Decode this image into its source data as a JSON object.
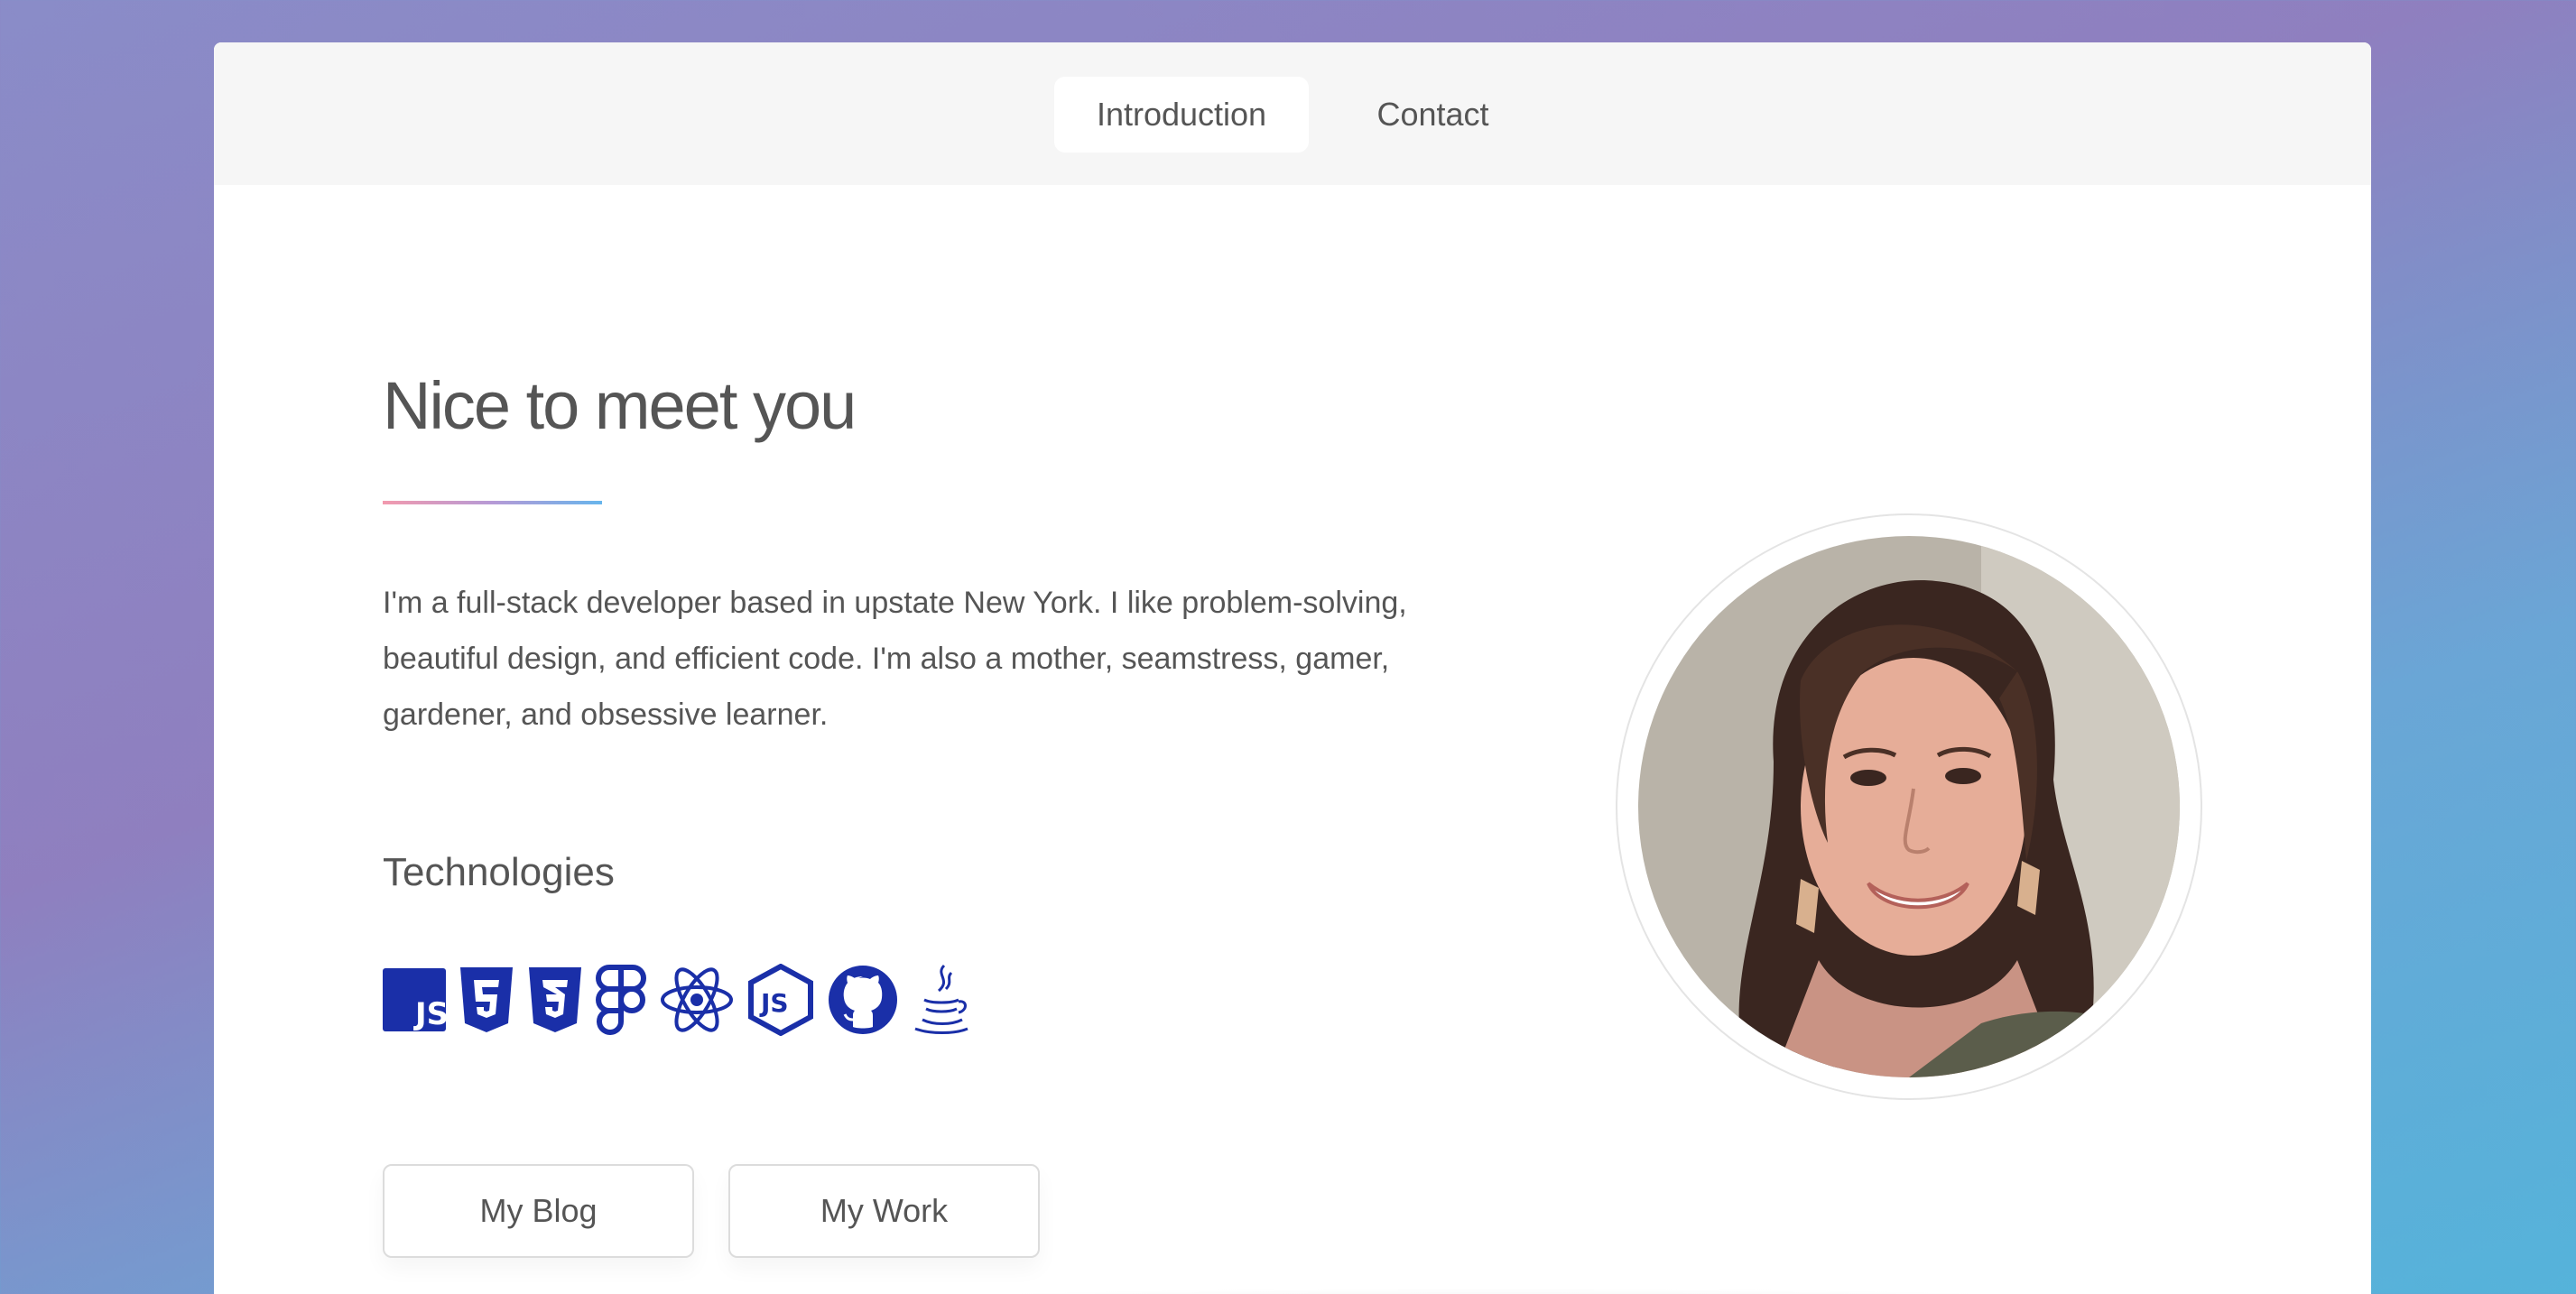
{
  "nav": {
    "items": [
      {
        "label": "Introduction",
        "active": true
      },
      {
        "label": "Contact",
        "active": false
      }
    ]
  },
  "intro": {
    "heading": "Nice to meet you",
    "bio": "I'm a full-stack developer based in upstate New York. I like problem-solving, beautiful design, and efficient code. I'm also a mother, seamstress, gamer, gardener, and obsessive learner.",
    "technologies_heading": "Technologies",
    "technologies": [
      "javascript-icon",
      "html5-icon",
      "css3-icon",
      "figma-icon",
      "react-icon",
      "nodejs-icon",
      "github-icon",
      "java-icon"
    ]
  },
  "buttons": {
    "blog": "My Blog",
    "work": "My Work"
  },
  "colors": {
    "icon": "#1a2fa8",
    "text": "#555555",
    "divider_start": "#f29aae",
    "divider_end": "#67b5ec"
  }
}
